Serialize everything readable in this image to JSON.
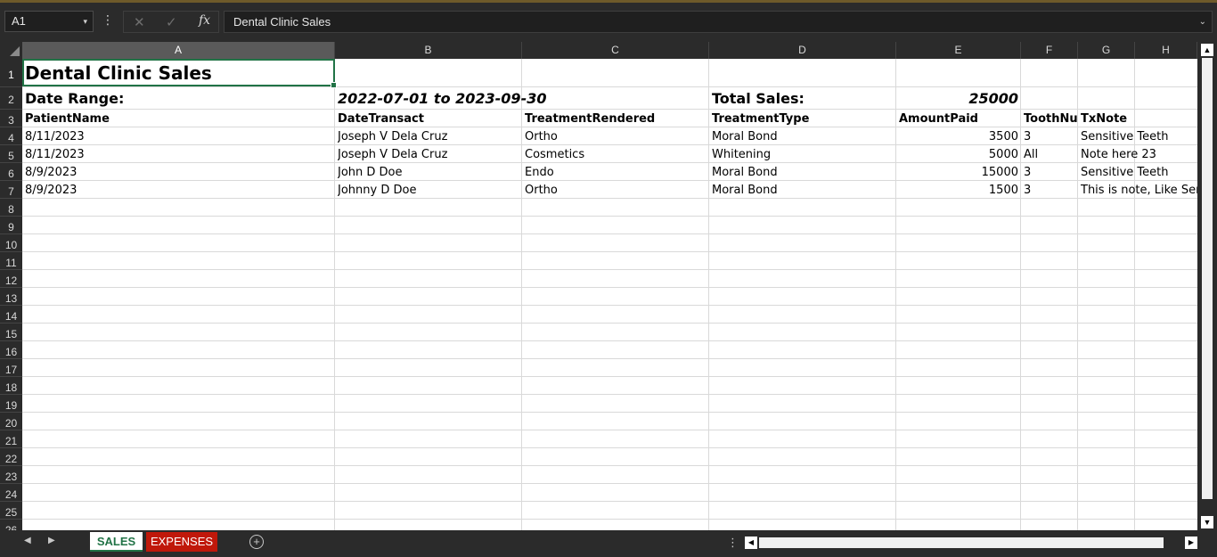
{
  "formula_bar": {
    "name_box": "A1",
    "name_box_dropdown": "▾",
    "more_icon": "⋮",
    "cancel_icon": "✕",
    "enter_icon": "✓",
    "fx_label": "fx",
    "content": "Dental Clinic Sales",
    "expand_icon": "⌄"
  },
  "columns": [
    "A",
    "B",
    "C",
    "D",
    "E",
    "F",
    "G",
    "H"
  ],
  "rows": [
    "1",
    "2",
    "3",
    "4",
    "5",
    "6",
    "7",
    "8",
    "9",
    "10",
    "11",
    "12",
    "13",
    "14",
    "15",
    "16",
    "17",
    "18",
    "19",
    "20",
    "21",
    "22",
    "23",
    "24",
    "25",
    "26"
  ],
  "sheet": {
    "title": "Dental Clinic Sales",
    "date_range_label": "Date Range:",
    "date_range_value": "2022-07-01 to 2023-09-30",
    "total_sales_label": "Total Sales:",
    "total_sales_value": "25000",
    "headers": [
      "PatientName",
      "DateTransact",
      "TreatmentRendered",
      "TreatmentType",
      "AmountPaid",
      "ToothNum",
      "TxNote"
    ],
    "data_rows": [
      [
        "8/11/2023",
        "Joseph V Dela Cruz",
        "Ortho",
        "Moral Bond",
        "3500",
        "3",
        "Sensitive Teeth"
      ],
      [
        "8/11/2023",
        "Joseph V Dela Cruz",
        "Cosmetics",
        "Whitening",
        "5000",
        "All",
        "Note here 23"
      ],
      [
        "8/9/2023",
        "John D Doe",
        "Endo",
        "Moral Bond",
        "15000",
        "3",
        "Sensitive Teeth"
      ],
      [
        "8/9/2023",
        "Johnny D Doe",
        "Ortho",
        "Moral Bond",
        "1500",
        "3",
        "This is note, Like Sensitive Teeth"
      ]
    ]
  },
  "tabs": {
    "prev_icon": "◀",
    "next_icon": "▶",
    "sheets": [
      "SALES",
      "EXPENSES"
    ],
    "add_icon": "+",
    "dots": "⋮"
  },
  "scrollbars": {
    "up": "▲",
    "down": "▼",
    "left": "◀",
    "right": "▶"
  }
}
